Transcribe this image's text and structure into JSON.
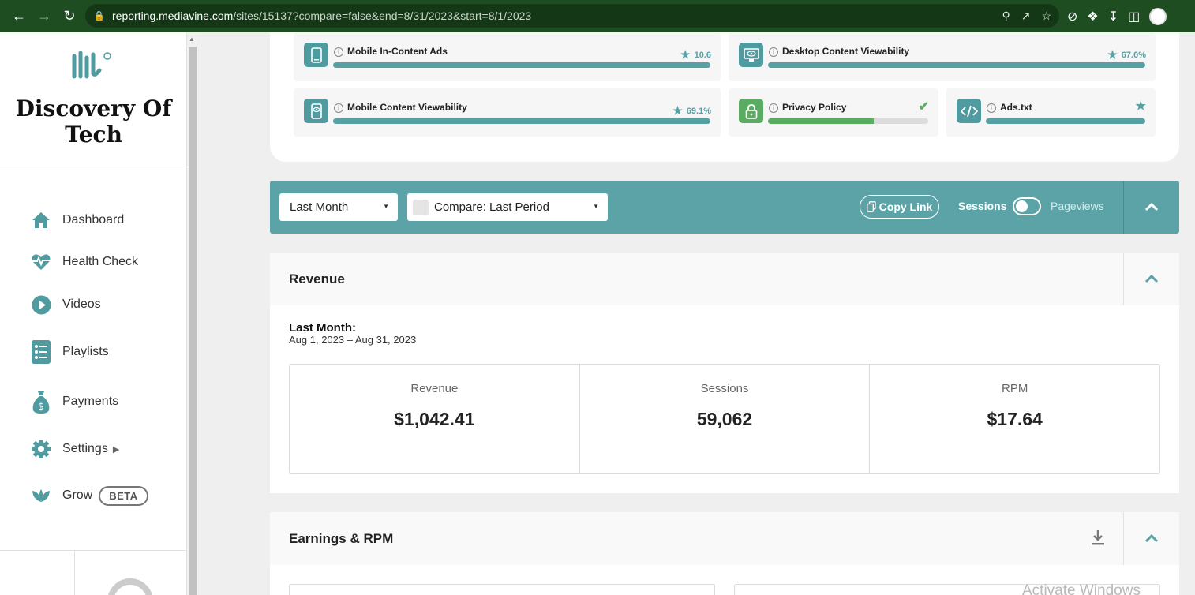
{
  "browser": {
    "url_host": "reporting.mediavine.com",
    "url_path": "/sites/15137?compare=false&end=8/31/2023&start=8/1/2023"
  },
  "sidebar": {
    "site_title": "Discovery Of Tech",
    "items": [
      {
        "label": "Dashboard",
        "icon": "home-icon"
      },
      {
        "label": "Health Check",
        "icon": "heartbeat-icon"
      },
      {
        "label": "Videos",
        "icon": "play-circle-icon"
      },
      {
        "label": "Playlists",
        "icon": "list-icon"
      },
      {
        "label": "Payments",
        "icon": "money-bag-icon"
      },
      {
        "label": "Settings",
        "icon": "gear-icon"
      },
      {
        "label": "Grow",
        "icon": "leaf-icon",
        "badge": "BETA"
      }
    ]
  },
  "health": {
    "items": [
      {
        "label": "Mobile In-Content Ads",
        "score": "10.6",
        "icon": "mobile-icon",
        "fill": 1.0
      },
      {
        "label": "Desktop Content Viewability",
        "score": "67.0%",
        "icon": "desktop-eye-icon",
        "fill": 1.0
      },
      {
        "label": "Mobile Content Viewability",
        "score": "69.1%",
        "icon": "mobile-eye-icon",
        "fill": 1.0
      },
      {
        "label": "Privacy Policy",
        "icon": "lock-icon",
        "fill": 0.66
      },
      {
        "label": "Ads.txt",
        "icon": "code-icon",
        "fill": 1.0
      }
    ]
  },
  "filters": {
    "period": "Last Month",
    "compare": "Compare: Last Period",
    "copy_link": "Copy Link",
    "sessions": "Sessions",
    "pageviews": "Pageviews"
  },
  "revenue": {
    "title": "Revenue",
    "period_title": "Last Month:",
    "period_range": "Aug 1, 2023 – Aug 31, 2023",
    "stats": [
      {
        "label": "Revenue",
        "value": "$1,042.41"
      },
      {
        "label": "Sessions",
        "value": "59,062"
      },
      {
        "label": "RPM",
        "value": "$17.64"
      }
    ]
  },
  "earnings": {
    "title": "Earnings & RPM"
  },
  "watermark": "Activate Windows",
  "colors": {
    "accent": "#5ba3a7",
    "accent_dark": "#4f9b9f",
    "success": "#5aac62",
    "browser_bar": "#1f4d22"
  }
}
